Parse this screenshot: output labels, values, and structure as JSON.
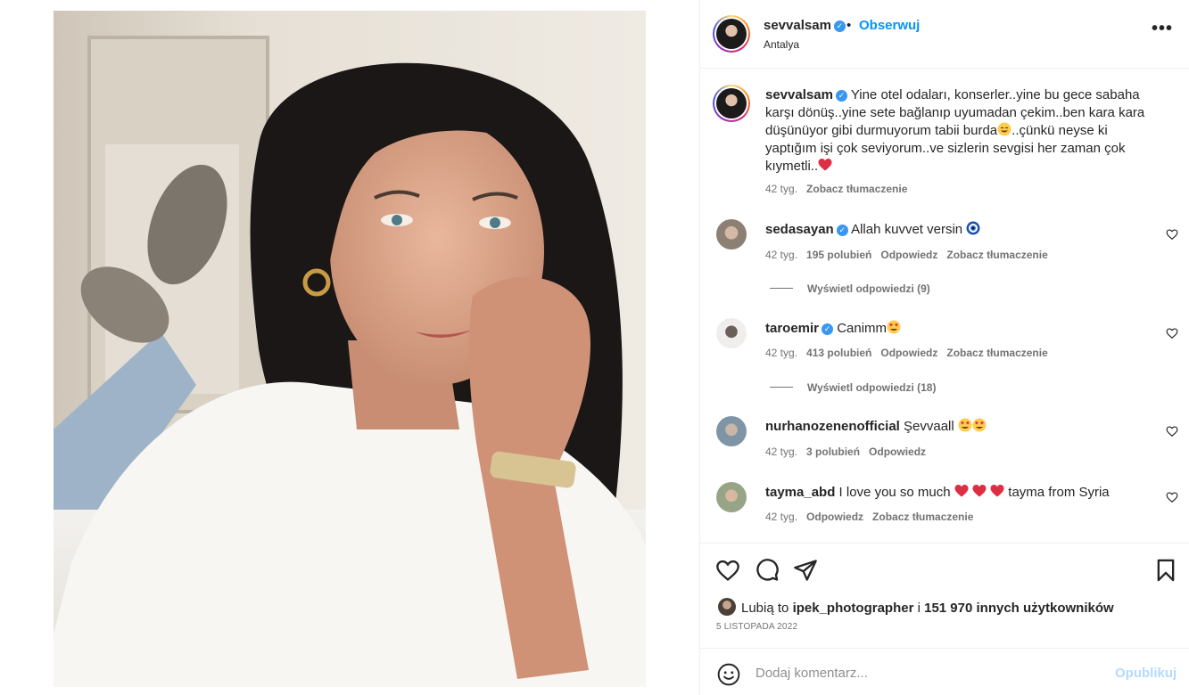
{
  "header": {
    "username": "sevvalsam",
    "follow_label": "Obserwuj",
    "separator": "•",
    "location": "Antalya",
    "more_label": "•••"
  },
  "caption": {
    "username": "sevvalsam",
    "text_1": "Yine otel odaları, konserler..yine bu gece sabaha karşı dönüş..yine sete bağlanıp uyumadan çekim..ben kara kara düşünüyor gibi durmuyorum tabii burda",
    "text_2": "..çünkü neyse ki yaptığım işi çok seviyorum..ve sizlerin sevgisi her zaman çok kıymetli..",
    "time": "42 tyg.",
    "translate": "Zobacz tłumaczenie"
  },
  "comments": [
    {
      "username": "sedasayan",
      "verified": true,
      "text": "Allah kuvvet versin",
      "emoji": "nazar-amulet-icon",
      "time": "42 tyg.",
      "likes": "195 polubień",
      "reply": "Odpowiedz",
      "translate": "Zobacz tłumaczenie",
      "view_replies": "Wyświetl odpowiedzi (9)"
    },
    {
      "username": "taroemir",
      "verified": true,
      "text": "Canimm",
      "emoji": "heart-eyes-emoji",
      "time": "42 tyg.",
      "likes": "413 polubień",
      "reply": "Odpowiedz",
      "translate": "Zobacz tłumaczenie",
      "view_replies": "Wyświetl odpowiedzi (18)"
    },
    {
      "username": "nurhanozenenofficial",
      "verified": false,
      "text": "Şevvaall",
      "emoji": "heart-eyes-emoji",
      "time": "42 tyg.",
      "likes": "3 polubień",
      "reply": "Odpowiedz"
    },
    {
      "username": "tayma_abd",
      "verified": false,
      "text_before": "I love you so much",
      "text_after": "tayma from Syria",
      "emoji": "red-heart-emoji",
      "time": "42 tyg.",
      "reply": "Odpowiedz",
      "translate": "Zobacz tłumaczenie"
    }
  ],
  "likes": {
    "prefix": "Lubią to",
    "user": "ipek_photographer",
    "connector": "i",
    "count_text": "151 970 innych użytkowników"
  },
  "date": "5 LISTOPADA 2022",
  "add_comment": {
    "placeholder": "Dodaj komentarz...",
    "publish_label": "Opublikuj"
  },
  "colors": {
    "accent": "#0095f6",
    "verified": "#3897f0",
    "muted": "#737373",
    "publish_disabled": "#b3dbff",
    "heart_red": "#ed4956"
  }
}
